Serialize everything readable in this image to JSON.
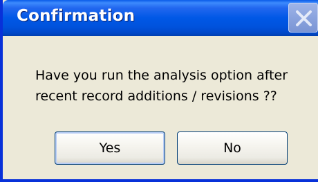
{
  "dialog": {
    "title": "Confirmation",
    "message_lines": [
      "Have you run the analysis option after",
      "recent record additions / revisions ??"
    ],
    "buttons": {
      "yes_label": "Yes",
      "no_label": "No"
    },
    "close_icon": "close-icon"
  },
  "colors": {
    "titlebar": "#0058e6",
    "window_frame": "#0831d9",
    "body_background": "#ece9d8",
    "button_border": "#003c74"
  }
}
